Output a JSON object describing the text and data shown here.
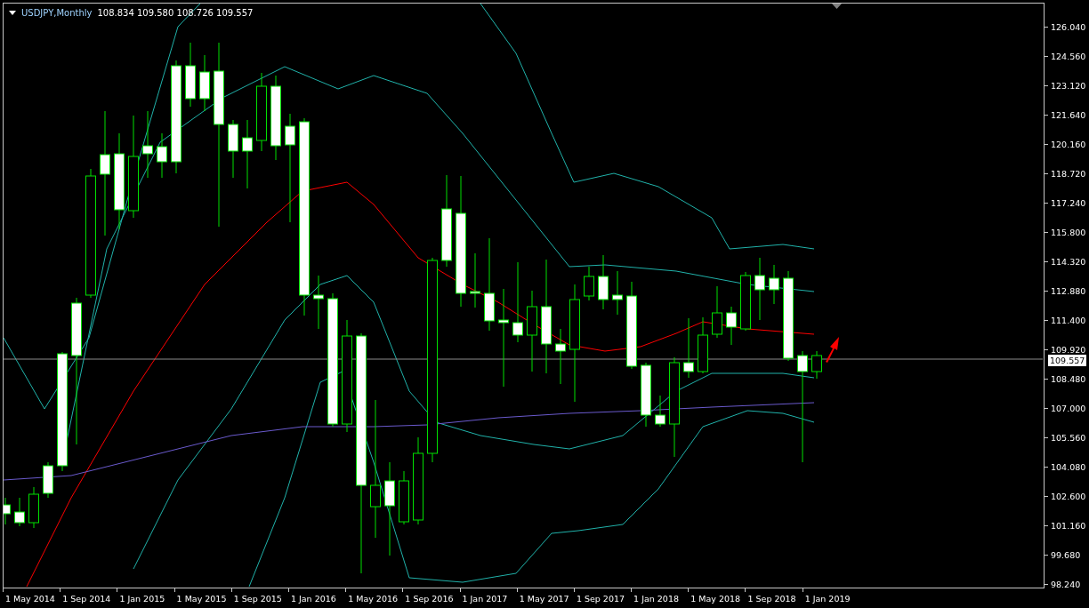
{
  "chart_header": {
    "symbol_period": "USDJPY,Monthly",
    "ohlc": "108.834 109.580 108.726 109.557"
  },
  "price_axis": {
    "labels": [
      "126.040",
      "124.560",
      "123.120",
      "121.640",
      "120.160",
      "118.720",
      "117.240",
      "115.800",
      "114.320",
      "112.880",
      "111.400",
      "109.920",
      "108.480",
      "107.000",
      "105.560",
      "104.080",
      "102.600",
      "101.160",
      "99.680",
      "98.240"
    ],
    "current_price": "109.557"
  },
  "time_axis": {
    "labels": [
      "1 May 2014",
      "1 Sep 2014",
      "1 Jan 2015",
      "1 May 2015",
      "1 Sep 2015",
      "1 Jan 2016",
      "1 May 2016",
      "1 Sep 2016",
      "1 Jan 2017",
      "1 May 2017",
      "1 Sep 2017",
      "1 Jan 2018",
      "1 May 2018",
      "1 Sep 2018",
      "1 Jan 2019"
    ]
  }
}
